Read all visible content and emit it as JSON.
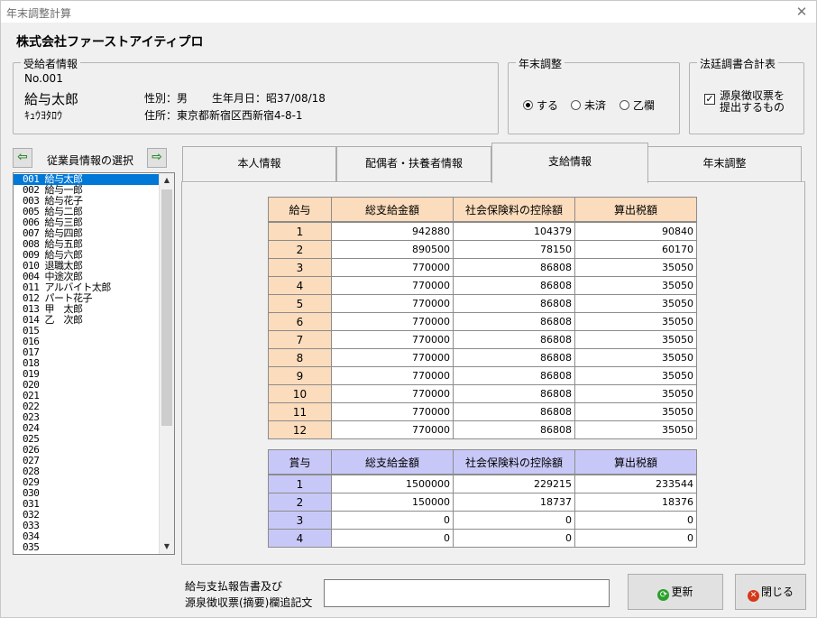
{
  "window": {
    "title": "年末調整計算",
    "close_glyph": "✕"
  },
  "company": "株式会社ファーストアイティプロ",
  "recipient": {
    "legend": "受給者情報",
    "no": "No.001",
    "name": "給与太郎",
    "kana": "ｷｭｳﾖﾀﾛｳ",
    "gender": "性別：男",
    "birthdate": "生年月日：昭37/08/18",
    "address": "住所：東京都新宿区西新宿4-8-1"
  },
  "year_end": {
    "legend": "年末調整",
    "options": [
      "する",
      "未済",
      "乙欄"
    ],
    "selected": "する"
  },
  "statutory": {
    "legend": "法廷調書合計表",
    "checkbox_label_1": "源泉徴収票を",
    "checkbox_label_2": "提出するもの",
    "checked": true
  },
  "employee_nav": {
    "label": "従業員情報の選択",
    "prev_glyph": "⇦",
    "next_glyph": "⇨"
  },
  "employees": [
    "001 給与太郎",
    "002 給与一郎",
    "003 給与花子",
    "005 給与二郎",
    "006 給与三郎",
    "007 給与四郎",
    "008 給与五郎",
    "009 給与六郎",
    "010 退職太郎",
    "004 中途次郎",
    "011 アルバイト太郎",
    "012 パート花子",
    "013 甲　太郎",
    "014 乙　次郎",
    "015",
    "016",
    "017",
    "018",
    "019",
    "020",
    "021",
    "022",
    "023",
    "024",
    "025",
    "026",
    "027",
    "028",
    "029",
    "030",
    "031",
    "032",
    "033",
    "034",
    "035"
  ],
  "selected_employee_index": 0,
  "tabs": [
    "本人情報",
    "配偶者・扶養者情報",
    "支給情報",
    "年末調整"
  ],
  "active_tab": 2,
  "salary_table": {
    "headers": [
      "給与",
      "総支給金額",
      "社会保険料の控除額",
      "算出税額"
    ],
    "rows": [
      [
        "1",
        "942880",
        "104379",
        "90840"
      ],
      [
        "2",
        "890500",
        "78150",
        "60170"
      ],
      [
        "3",
        "770000",
        "86808",
        "35050"
      ],
      [
        "4",
        "770000",
        "86808",
        "35050"
      ],
      [
        "5",
        "770000",
        "86808",
        "35050"
      ],
      [
        "6",
        "770000",
        "86808",
        "35050"
      ],
      [
        "7",
        "770000",
        "86808",
        "35050"
      ],
      [
        "8",
        "770000",
        "86808",
        "35050"
      ],
      [
        "9",
        "770000",
        "86808",
        "35050"
      ],
      [
        "10",
        "770000",
        "86808",
        "35050"
      ],
      [
        "11",
        "770000",
        "86808",
        "35050"
      ],
      [
        "12",
        "770000",
        "86808",
        "35050"
      ]
    ]
  },
  "bonus_table": {
    "headers": [
      "賞与",
      "総支給金額",
      "社会保険料の控除額",
      "算出税額"
    ],
    "rows": [
      [
        "1",
        "1500000",
        "229215",
        "233544"
      ],
      [
        "2",
        "150000",
        "18737",
        "18376"
      ],
      [
        "3",
        "0",
        "0",
        "0"
      ],
      [
        "4",
        "0",
        "0",
        "0"
      ]
    ]
  },
  "footer": {
    "memo_label_1": "給与支払報告書及び",
    "memo_label_2": "源泉徴収票(摘要)欄追記文",
    "memo_value": "",
    "update_label": "更新",
    "close_label": "閉じる"
  },
  "colors": {
    "salary_header": "#fbdcbc",
    "bonus_header": "#c8c8f8",
    "selection": "#0078d7"
  }
}
